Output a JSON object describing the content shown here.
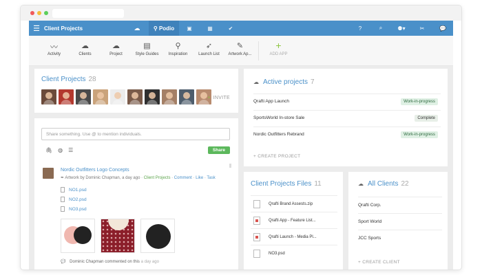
{
  "topbar": {
    "workspace_title": "Client Projects",
    "logo_text": "Podio"
  },
  "apps": [
    {
      "label": "Activity",
      "icon": "activity-icon",
      "glyph": "〰"
    },
    {
      "label": "Clients",
      "icon": "clients-icon",
      "glyph": "☁"
    },
    {
      "label": "Project",
      "icon": "project-icon",
      "glyph": "☁"
    },
    {
      "label": "Style Guides",
      "icon": "style-guides-icon",
      "glyph": "▤"
    },
    {
      "label": "Inspiration",
      "icon": "inspiration-icon",
      "glyph": "⚲"
    },
    {
      "label": "Launch List",
      "icon": "launch-list-icon",
      "glyph": "➶"
    },
    {
      "label": "Artwork Ap...",
      "icon": "artwork-icon",
      "glyph": "✎"
    }
  ],
  "add_app": {
    "label": "ADD APP"
  },
  "client_projects": {
    "title": "Client Projects",
    "count": "28",
    "invite_label": "INVITE",
    "avatar_colors": [
      "#6b4a3a",
      "#b3392f",
      "#4a4a4a",
      "#caa37b",
      "#ececec",
      "#7a5b4a",
      "#2f2f2f",
      "#a47f66",
      "#4e5d6c",
      "#b88b6e"
    ]
  },
  "stream": {
    "share_placeholder": "Share something. Use @ to mention individuals.",
    "share_button": "Share",
    "post": {
      "title": "Nordic Outfitters Logo Concepts",
      "meta_prefix": "Artwork by Dominic Chapman, a day ago ·",
      "meta_space": "Client Projects",
      "actions": [
        "Comment",
        "Like",
        "Task"
      ]
    },
    "files": [
      "NO1.psd",
      "NO2.psd",
      "NO3.psd"
    ],
    "comment": {
      "author": "Dominic Chapman",
      "text": "commented on this",
      "time": "a day ago"
    }
  },
  "active_projects": {
    "title": "Active projects",
    "count": "7",
    "rows": [
      {
        "name": "Qrafti App Launch",
        "status": "Work-in-progress"
      },
      {
        "name": "SportsWorld In-store Sale",
        "status": "Complete"
      },
      {
        "name": "Nordic Outfitters Rebrand",
        "status": "Work-in-progress"
      }
    ],
    "create_label": "+ CREATE PROJECT"
  },
  "files_card": {
    "title": "Client Projects Files",
    "count": "11",
    "rows": [
      "Qrafti Brand Assests.zip",
      "Qrafti App - Feature List...",
      "Qrafti Launch - Media Pl...",
      "NO3.psd"
    ]
  },
  "clients_card": {
    "title": "All Clients",
    "count": "22",
    "rows": [
      "Qrafti Corp.",
      "Sport World",
      "JCC Sports"
    ],
    "create_label": "+ CREATE CLIENT"
  },
  "colors": {
    "accent": "#4a90c9",
    "success": "#5cb85c",
    "add_app": "#8cc540"
  }
}
